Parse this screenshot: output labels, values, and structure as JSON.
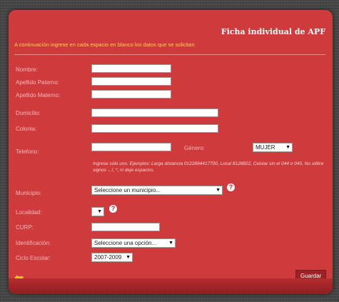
{
  "header": {
    "title": "Ficha individual de APF",
    "instructions": "A continuación ingrese en cada espacio en blanco los datos que se solicitan"
  },
  "form": {
    "nombre_label": "Nombre:",
    "apellido_paterno_label": "Apellido Paterno:",
    "apellido_materno_label": "Apellido Materno:",
    "domicilio_label": "Domicilio:",
    "colonia_label": "Colonia:",
    "telefono_label": "Telefono:",
    "genero_label": "Género:",
    "genero_value": "MUJER",
    "telefono_note": "Ingrese sólo uno. Ejemplos: Larga distancia 0122894417700, Local 8128822, Celular sin el 044 o 045. No utilice signos -, /, *, ni deje espacios.",
    "municipio_label": "Municipio:",
    "municipio_value": "Seleccione un municipio...",
    "localidad_label": "Localidad:",
    "curp_label": "CURP:",
    "identificacion_label": "Identificación:",
    "identificacion_value": "Seleccione una opción...",
    "ciclo_label": "Ciclo Escolar:",
    "ciclo_value": "2007-2009"
  },
  "footer": {
    "save_label": "Guardar",
    "back_icon": "arrow-left-icon"
  },
  "colors": {
    "panel": "#cf3b3d",
    "instructions": "#ffd24d",
    "label": "#f4b7b7"
  }
}
